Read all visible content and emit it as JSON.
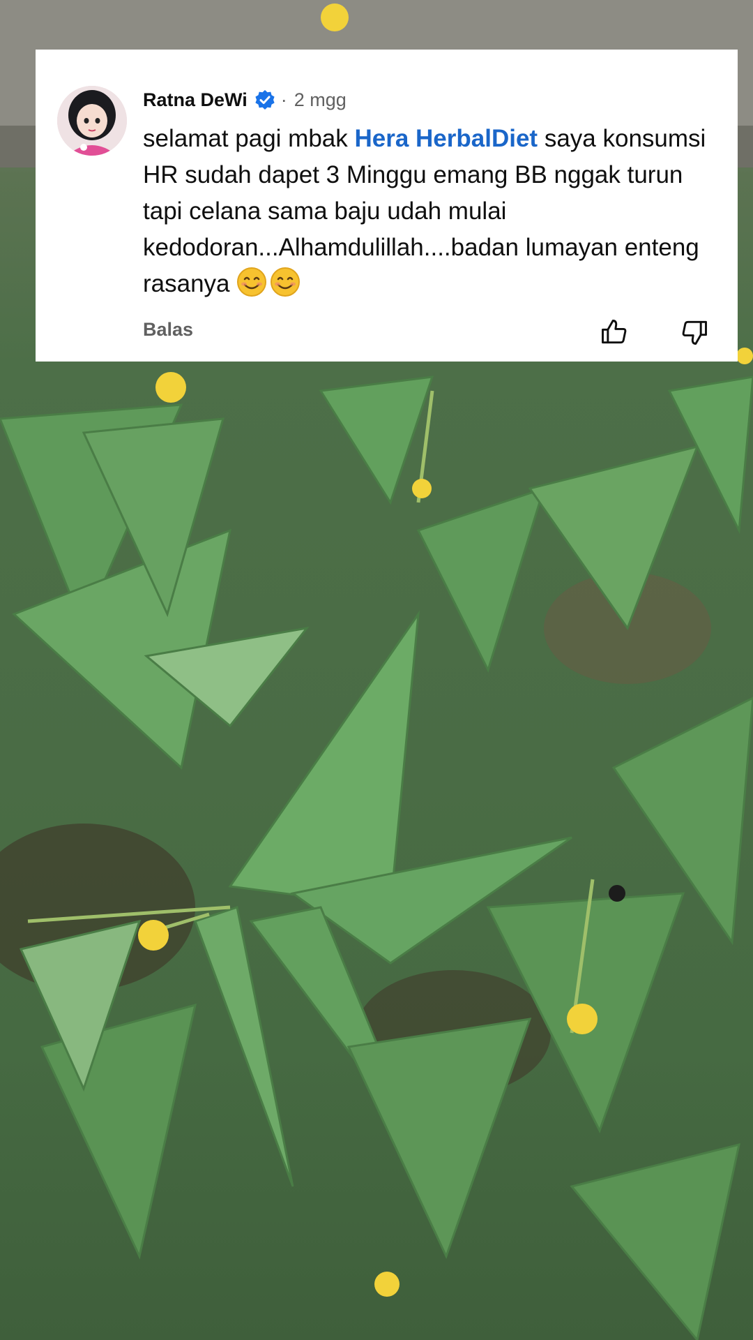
{
  "comment": {
    "author": "Ratna DeWi",
    "separator": "·",
    "time_ago": "2 mgg",
    "text_before_mention": "selamat pagi mbak ",
    "mention": "Hera HerbalDiet",
    "text_after_mention": " saya konsumsi HR sudah dapet 3 Minggu emang BB nggak turun tapi celana sama baju udah mulai kedodoran...Alhamdulillah....badan lumayan enteng rasanya ",
    "emojis": [
      "smiling-face-emoji",
      "smiling-face-emoji"
    ],
    "reply_label": "Balas",
    "icons": {
      "verified": "verified-check-icon",
      "like": "thumbs-up-icon",
      "dislike": "thumbs-down-icon"
    }
  },
  "colors": {
    "mention": "#1a66c9",
    "verified": "#1a73e8",
    "secondary_text": "#606060",
    "card_background": "#ffffff"
  }
}
